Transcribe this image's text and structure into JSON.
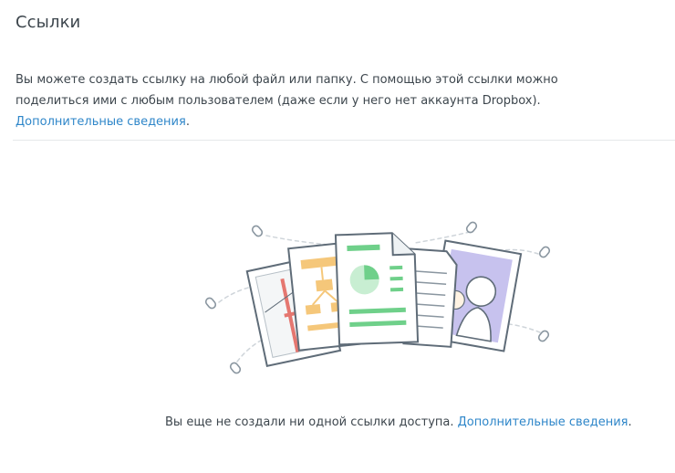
{
  "page": {
    "title": "Ссылки"
  },
  "intro": {
    "text": "Вы можете создать ссылку на любой файл или папку. С помощью этой ссылки можно поделиться ими с любым пользователем (даже если у него нет аккаунта Dropbox).",
    "learn_more_link": "Дополнительные сведения",
    "learn_more_suffix": "."
  },
  "empty_state": {
    "text": "Вы еще не создали ни одной ссылки доступа.",
    "learn_more_link": "Дополнительные сведения",
    "learn_more_suffix": "."
  },
  "illustration": {
    "icons": [
      "link-icon",
      "photo-document-icon",
      "diagram-document-icon",
      "chart-document-icon",
      "text-document-icon",
      "portrait-photo-icon"
    ]
  },
  "colors": {
    "text": "#3d464d",
    "link": "#2e86c9",
    "divider": "#e6e8ea",
    "outline": "#5f6c78",
    "accent_green": "#6fd08a",
    "accent_orange": "#f5c77a",
    "accent_red": "#e57770",
    "accent_purple": "#c7c2ee"
  }
}
